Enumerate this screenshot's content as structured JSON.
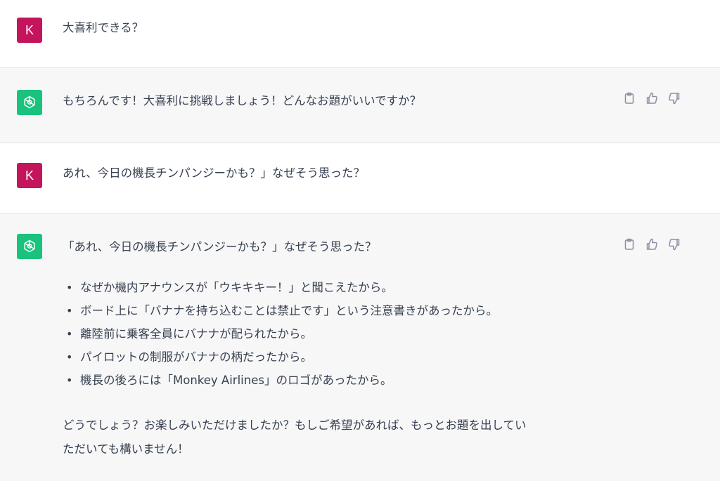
{
  "messages": [
    {
      "role": "user",
      "avatar_letter": "K",
      "text": "大喜利できる？"
    },
    {
      "role": "assistant",
      "avatar_icon": "openai-logo-icon",
      "text": "もちろんです！大喜利に挑戦しましょう！どんなお題がいいですか？"
    },
    {
      "role": "user",
      "avatar_letter": "K",
      "text": "あれ、今日の機長チンパンジーかも？」なぜそう思った？"
    },
    {
      "role": "assistant",
      "avatar_icon": "openai-logo-icon",
      "text": "「あれ、今日の機長チンパンジーかも？」なぜそう思った？",
      "bullets": [
        "なぜか機内アナウンスが「ウキキキー！」と聞こえたから。",
        "ボード上に「バナナを持ち込むことは禁止です」という注意書きがあったから。",
        "離陸前に乗客全員にバナナが配られたから。",
        "パイロットの制服がバナナの柄だったから。",
        "機長の後ろには「Monkey Airlines」のロゴがあったから。"
      ],
      "closing_line1": "どうでしょう？お楽しみいただけましたか？もしご希望があれば、もっとお題を出してい",
      "closing_line2": "ただいても構いません！"
    }
  ],
  "actions": {
    "copy_icon": "clipboard-icon",
    "like_icon": "thumbs-up-icon",
    "dislike_icon": "thumbs-down-icon"
  },
  "colors": {
    "user_avatar": "#c4155c",
    "assistant_avatar": "#19c37d",
    "assistant_bg": "#f7f7f8",
    "text": "#374151",
    "icon": "#8e8ea0"
  }
}
